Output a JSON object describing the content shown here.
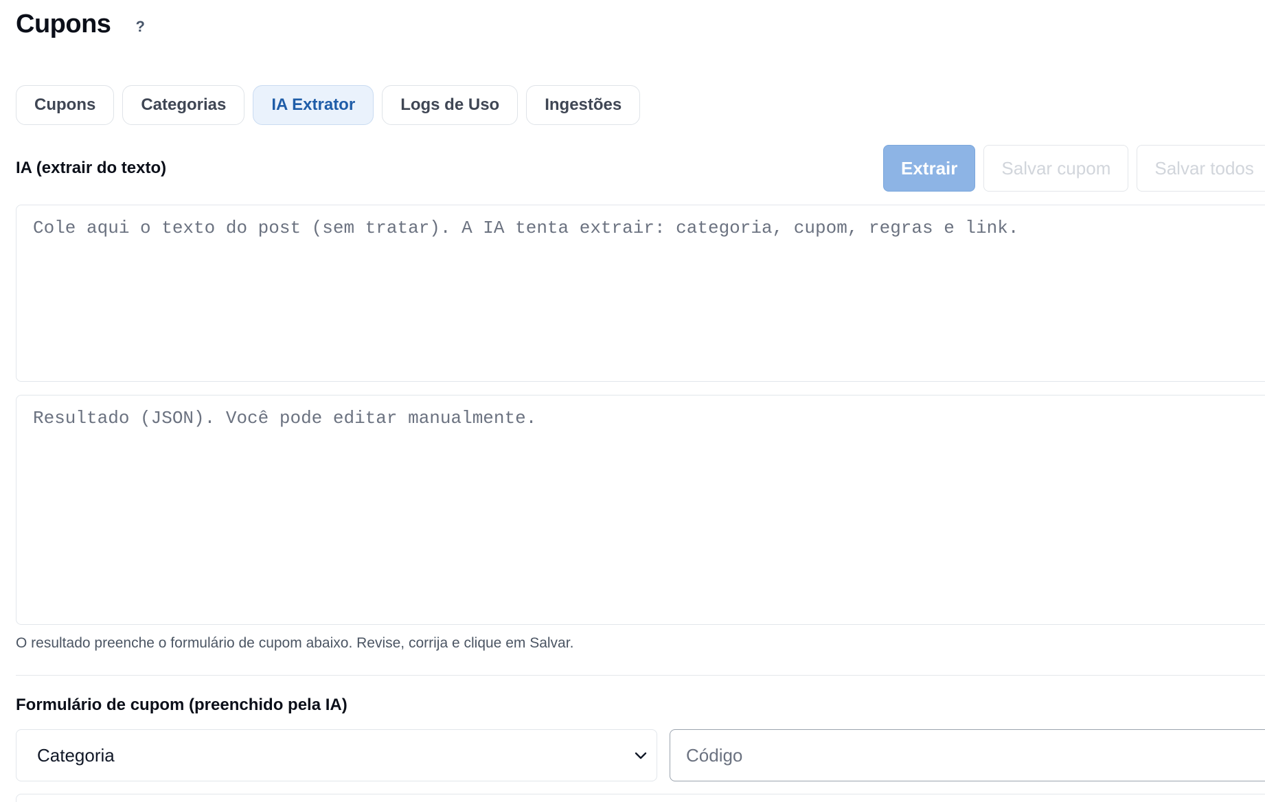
{
  "header": {
    "title": "Cupons",
    "help_label": "?"
  },
  "tabs": [
    {
      "label": "Cupons",
      "active": false
    },
    {
      "label": "Categorias",
      "active": false
    },
    {
      "label": "IA Extrator",
      "active": true
    },
    {
      "label": "Logs de Uso",
      "active": false
    },
    {
      "label": "Ingestões",
      "active": false
    }
  ],
  "extractor": {
    "section_title": "IA (extrair do texto)",
    "extract_label": "Extrair",
    "save_coupon_label": "Salvar cupom",
    "save_all_label": "Salvar todos",
    "input_placeholder": "Cole aqui o texto do post (sem tratar). A IA tenta extrair: categoria, cupom, regras e link.",
    "result_placeholder": "Resultado (JSON). Você pode editar manualmente.",
    "helper_text": "O resultado preenche o formulário de cupom abaixo. Revise, corrija e clique em Salvar."
  },
  "form": {
    "title": "Formulário de cupom (preenchido pela IA)",
    "category_selected": "Categoria",
    "code_placeholder": "Código"
  },
  "colors": {
    "accent": "#1f5da8",
    "primary_button": "#8db4e5",
    "active_tab_bg": "#eaf2fc"
  },
  "icons": {
    "help": "question-mark",
    "select": "chevron-down-icon"
  }
}
